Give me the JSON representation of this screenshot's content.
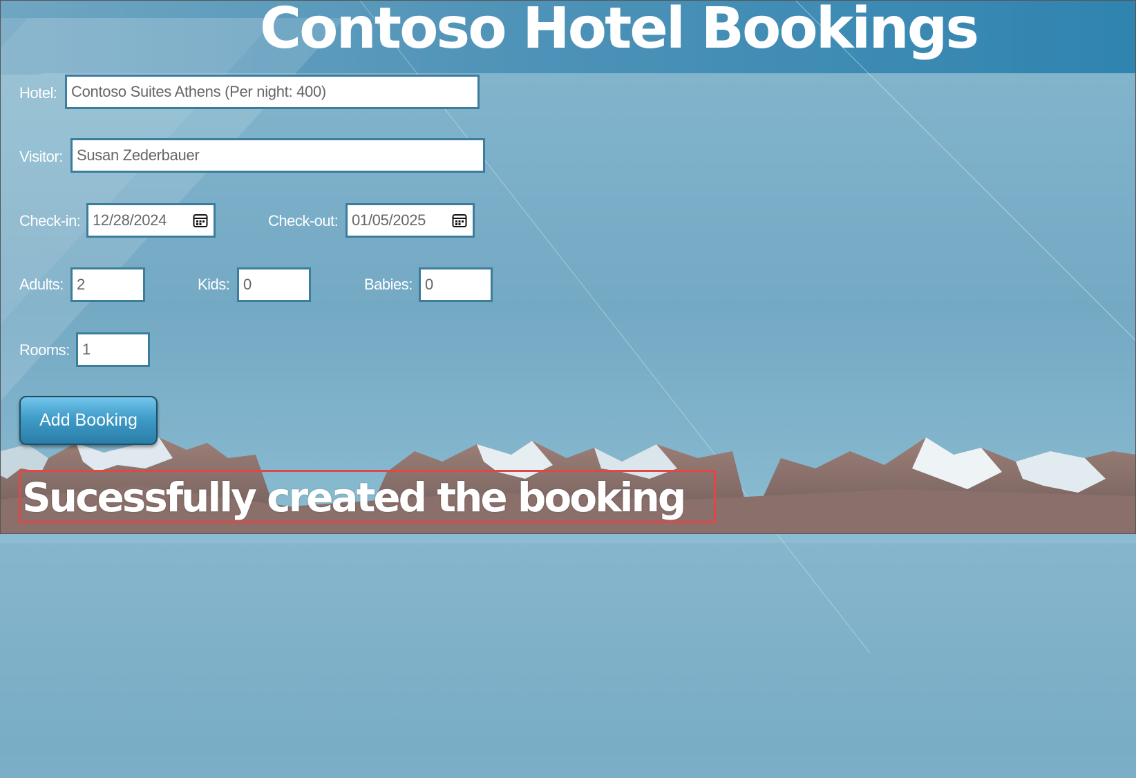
{
  "header": {
    "title": "Contoso Hotel Bookings"
  },
  "form": {
    "hotel": {
      "label": "Hotel:",
      "value": "Contoso Suites Athens (Per night: 400)"
    },
    "visitor": {
      "label": "Visitor:",
      "value": "Susan Zederbauer"
    },
    "checkin": {
      "label": "Check-in:",
      "value": "12/28/2024"
    },
    "checkout": {
      "label": "Check-out:",
      "value": "01/05/2025"
    },
    "adults": {
      "label": "Adults:",
      "value": "2"
    },
    "kids": {
      "label": "Kids:",
      "value": "0"
    },
    "babies": {
      "label": "Babies:",
      "value": "0"
    },
    "rooms": {
      "label": "Rooms:",
      "value": "1"
    },
    "submit_label": "Add Booking"
  },
  "status": {
    "message": "Sucessfully created the booking"
  },
  "icons": {
    "date_picker": "calendar-icon"
  },
  "colors": {
    "field_border": "#3b7d9b",
    "button": "#3f9cc8",
    "status_highlight": "#e04848",
    "header_band": "#2f84b0"
  }
}
